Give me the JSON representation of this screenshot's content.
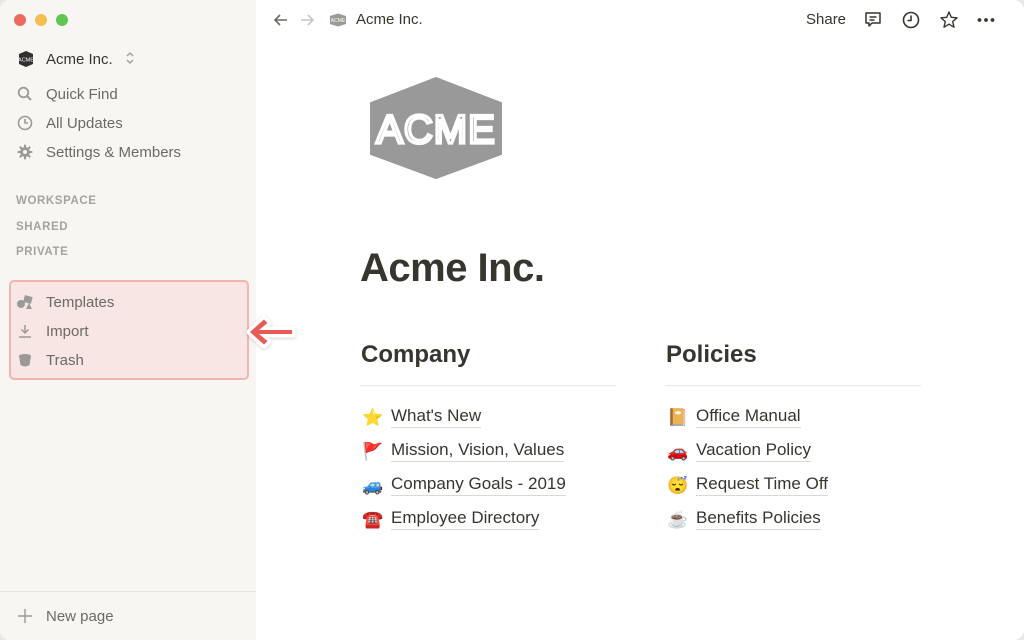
{
  "window": {
    "traffic_lights": [
      "close",
      "minimize",
      "zoom"
    ]
  },
  "sidebar": {
    "workspace_name": "Acme Inc.",
    "workspace_logo_text": "ACME",
    "menu": [
      {
        "label": "Quick Find",
        "icon": "search-icon"
      },
      {
        "label": "All Updates",
        "icon": "clock-icon"
      },
      {
        "label": "Settings & Members",
        "icon": "gear-icon"
      }
    ],
    "sections": [
      "WORKSPACE",
      "SHARED",
      "PRIVATE"
    ],
    "highlighted_items": [
      {
        "label": "Templates",
        "icon": "templates-icon"
      },
      {
        "label": "Import",
        "icon": "download-icon"
      },
      {
        "label": "Trash",
        "icon": "trash-icon"
      }
    ],
    "new_page_label": "New page",
    "highlight_color": "#f1b4ae",
    "arrow_color": "#e95a56"
  },
  "topbar": {
    "breadcrumb": "Acme Inc.",
    "share_label": "Share",
    "icons": [
      "comment-icon",
      "history-icon",
      "star-icon",
      "more-icon"
    ]
  },
  "page": {
    "logo_text": "ACME",
    "title": "Acme Inc.",
    "columns": [
      {
        "heading": "Company",
        "links": [
          {
            "emoji": "⭐",
            "label": "What's New"
          },
          {
            "emoji": "🚩",
            "label": "Mission, Vision, Values"
          },
          {
            "emoji": "🚙",
            "label": "Company Goals - 2019"
          },
          {
            "emoji": "☎️",
            "label": "Employee Directory"
          }
        ]
      },
      {
        "heading": "Policies",
        "links": [
          {
            "emoji": "📔",
            "label": "Office Manual"
          },
          {
            "emoji": "🚗",
            "label": "Vacation Policy"
          },
          {
            "emoji": "😴",
            "label": "Request Time Off"
          },
          {
            "emoji": "☕",
            "label": "Benefits Policies"
          }
        ]
      }
    ]
  }
}
